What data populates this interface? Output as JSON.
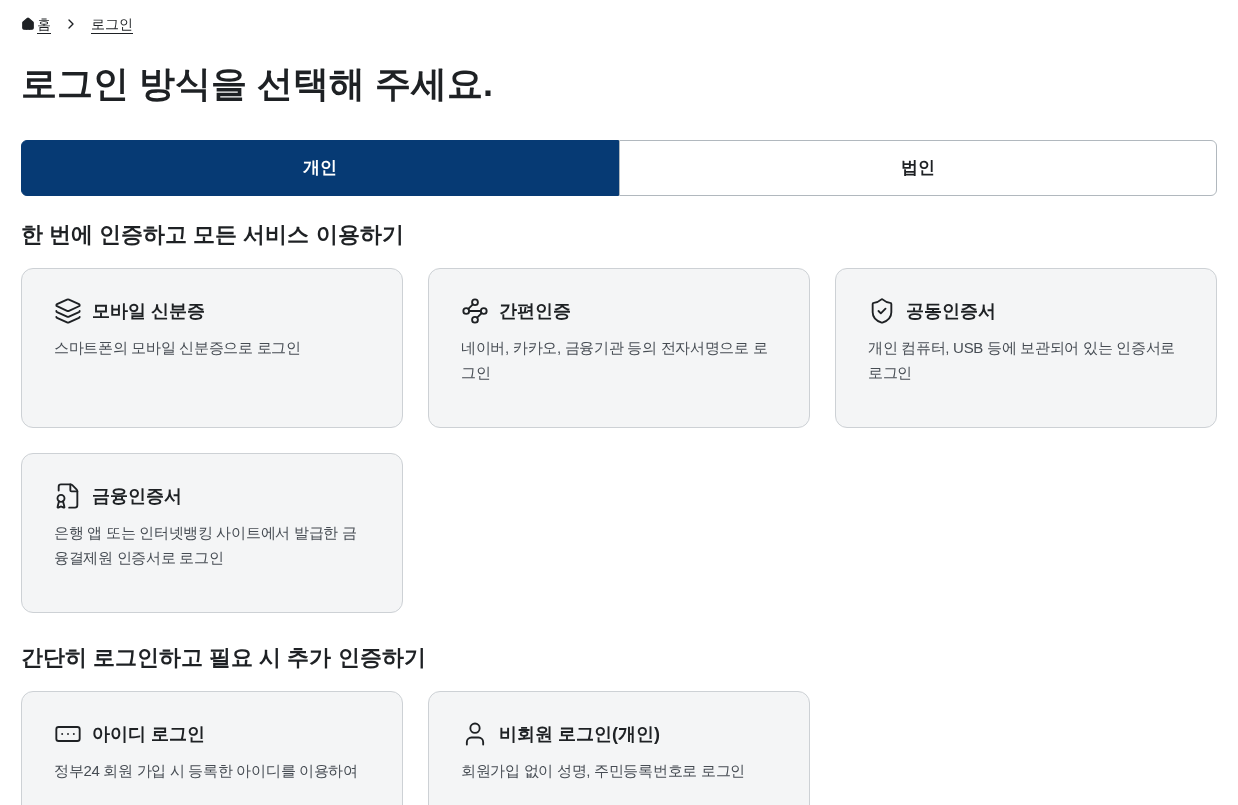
{
  "breadcrumb": [
    {
      "label": "홈",
      "kind": "home"
    },
    {
      "label": "로그인",
      "kind": "page"
    }
  ],
  "title": "로그인 방식을 선택해 주세요.",
  "tabs": [
    {
      "label": "개인",
      "selected": true
    },
    {
      "label": "법인",
      "selected": false
    }
  ],
  "sections": [
    {
      "heading": "한 번에 인증하고 모든 서비스 이용하기",
      "cards": [
        {
          "kind": "mobile-id",
          "title": "모바일 신분증",
          "description": "스마트폰의 모바일 신분증으로 로그인"
        },
        {
          "kind": "simple",
          "title": "간편인증",
          "description": "네이버, 카카오, 금융기관 등의 전자서명으로 로그인"
        },
        {
          "kind": "joint",
          "title": "공동인증서",
          "description": "개인 컴퓨터, USB 등에 보관되어 있는 인증서로 로그인"
        },
        {
          "kind": "financial",
          "title": "금융인증서",
          "description": "은행 앱 또는 인터넷뱅킹 사이트에서 발급한 금융결제원 인증서로 로그인"
        }
      ]
    },
    {
      "heading": "간단히 로그인하고 필요 시 추가 인증하기",
      "cards": [
        {
          "kind": "id",
          "title": "아이디 로그인",
          "description": "정부24 회원 가입 시 등록한 아이디를 이용하여"
        },
        {
          "kind": "guest",
          "title": "비회원 로그인(개인)",
          "description": "회원가입 없이 성명, 주민등록번호로 로그인"
        }
      ]
    }
  ]
}
